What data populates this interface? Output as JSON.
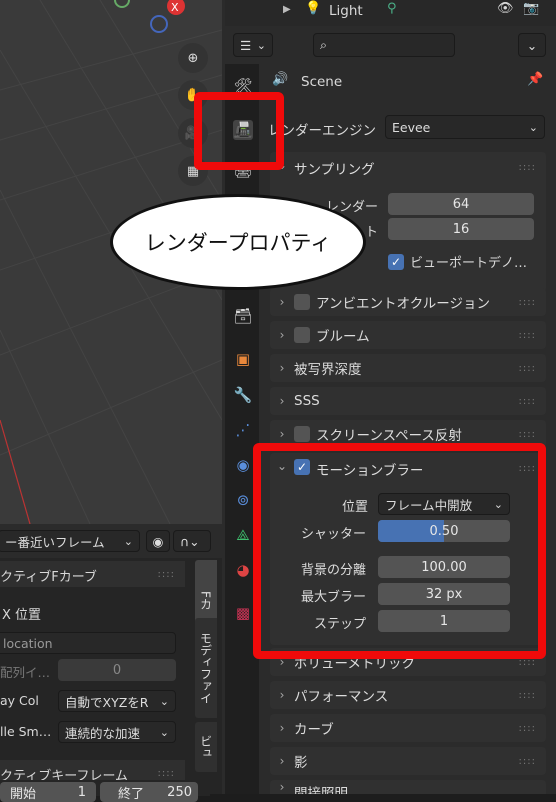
{
  "outliner": {
    "light_label": "Light"
  },
  "properties": {
    "search_placeholder": "",
    "scene_label": "Scene",
    "render_engine_label": "レンダーエンジン",
    "render_engine_value": "Eevee"
  },
  "sampling": {
    "title": "サンプリング",
    "render_label": "レンダー",
    "render_value": "64",
    "viewport_label": "ト",
    "viewport_value": "16",
    "denoise_label": "ビューポートデノ…"
  },
  "panels": {
    "ao": "アンビエントオクルージョン",
    "bloom": "ブルーム",
    "dof": "被写界深度",
    "sss": "SSS",
    "ssr": "スクリーンスペース反射",
    "volumetric": "ボリューメトリック",
    "performance": "パフォーマンス",
    "curves": "カーブ",
    "shadows": "影",
    "indirect": "間接照明"
  },
  "motion_blur": {
    "title": "モーションブラー",
    "position_label": "位置",
    "position_value": "フレーム中開放",
    "shutter_label": "シャッター",
    "shutter_value": "0.50",
    "shutter_fraction": 0.5,
    "bg_sep_label": "背景の分離",
    "bg_sep_value": "100.00",
    "max_blur_label": "最大ブラー",
    "max_blur_value": "32 px",
    "steps_label": "ステップ",
    "steps_value": "1"
  },
  "callout": {
    "text": "レンダープロパティ"
  },
  "timeline": {
    "nearest_frame": "ー番近いフレーム",
    "active_fcurve": "クティブFカーブ",
    "x_location": "X 位置",
    "data_path": "location",
    "array_index_label": "配列イ…",
    "array_index_value": "0",
    "array_color_label": "ay Col",
    "array_color_value": "自動でXYZをR",
    "auto_smoothing_label": "lle Sm…",
    "auto_smoothing_value": "連続的な加速",
    "active_keyframe": "クティブキーフレーム",
    "start_label": "開始",
    "start_value": "1",
    "end_label": "終了",
    "end_value": "250",
    "tab_f": "Fカ",
    "tab_modifiers": "モディファイ",
    "tab_view": "ビュ"
  },
  "colors": {
    "accent": "#4772b3",
    "highlight": "#f00a0a",
    "panel_bg": "#303030"
  }
}
